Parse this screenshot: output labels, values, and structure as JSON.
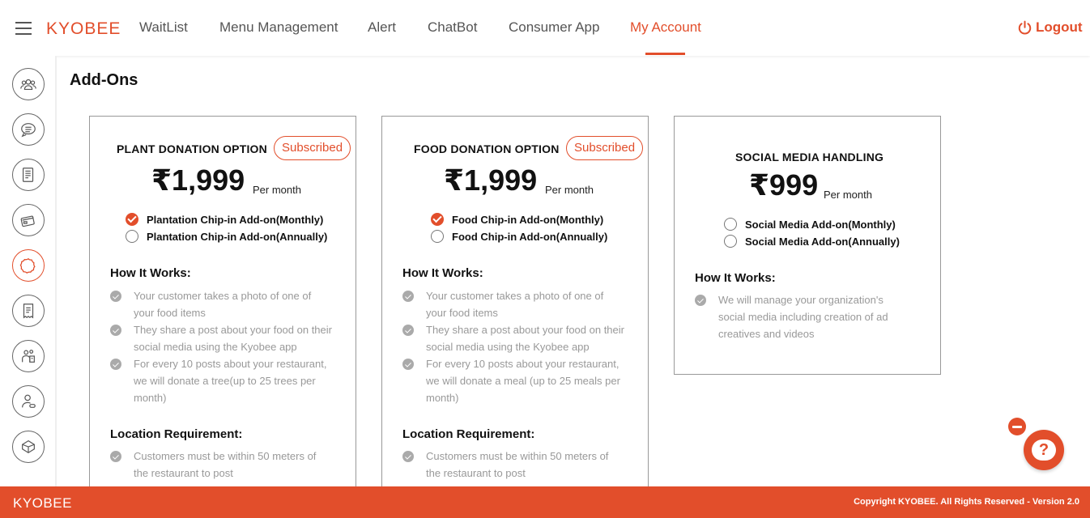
{
  "header": {
    "brand": "KYOBEE",
    "nav": [
      {
        "label": "WaitList"
      },
      {
        "label": "Menu Management"
      },
      {
        "label": "Alert"
      },
      {
        "label": "ChatBot"
      },
      {
        "label": "Consumer App"
      },
      {
        "label": "My Account"
      }
    ],
    "active_nav": "My Account",
    "logout_label": "Logout"
  },
  "sidebar": {
    "items": [
      {
        "icon": "group-icon"
      },
      {
        "icon": "chat-lines-icon"
      },
      {
        "icon": "document-icon"
      },
      {
        "icon": "card-icon"
      },
      {
        "icon": "flower-badge-icon",
        "active": true
      },
      {
        "icon": "receipt-icon"
      },
      {
        "icon": "people-building-icon"
      },
      {
        "icon": "user-link-icon"
      },
      {
        "icon": "gem-icon"
      }
    ]
  },
  "page": {
    "title": "Add-Ons"
  },
  "cards": [
    {
      "title": "PLANT DONATION OPTION",
      "badge": "Subscribed",
      "price": "₹1,999",
      "per": "Per month",
      "options": [
        {
          "label": "Plantation Chip-in Add-on(Monthly)",
          "checked": true
        },
        {
          "label": "Plantation Chip-in Add-on(Annually)",
          "checked": false
        }
      ],
      "how_title": "How It Works:",
      "how": [
        "Your customer takes a photo of one of your food items",
        "They share a post about your food on their social media using the Kyobee app",
        "For every 10 posts about your restaurant, we will donate a tree(up to 25 trees per month)"
      ],
      "loc_title": "Location Requirement:",
      "loc": [
        "Customers must be within 50 meters of the restaurant to post"
      ]
    },
    {
      "title": "FOOD DONATION OPTION",
      "badge": "Subscribed",
      "price": "₹1,999",
      "per": "Per month",
      "options": [
        {
          "label": "Food Chip-in Add-on(Monthly)",
          "checked": true
        },
        {
          "label": "Food Chip-in Add-on(Annually)",
          "checked": false
        }
      ],
      "how_title": "How It Works:",
      "how": [
        "Your customer takes a photo of one of your food items",
        "They share a post about your food on their social media using the Kyobee app",
        "For every 10 posts about your restaurant, we will donate a meal (up to 25 meals per month)"
      ],
      "loc_title": "Location Requirement:",
      "loc": [
        "Customers must be within 50 meters of the restaurant to post"
      ]
    },
    {
      "title": "SOCIAL MEDIA HANDLING",
      "price": "₹999",
      "per": "Per month",
      "options": [
        {
          "label": "Social Media Add-on(Monthly)",
          "checked": false
        },
        {
          "label": "Social Media Add-on(Annually)",
          "checked": false
        }
      ],
      "how_title": "How It Works:",
      "how": [
        "We will manage your organization's social media including creation of ad creatives and videos"
      ]
    }
  ],
  "footer": {
    "brand": "KYOBEE",
    "copyright": "Copyright KYOBEE. All Rights Reserved - Version 2.0"
  },
  "colors": {
    "accent": "#e24e2b",
    "muted_text": "#999999"
  }
}
